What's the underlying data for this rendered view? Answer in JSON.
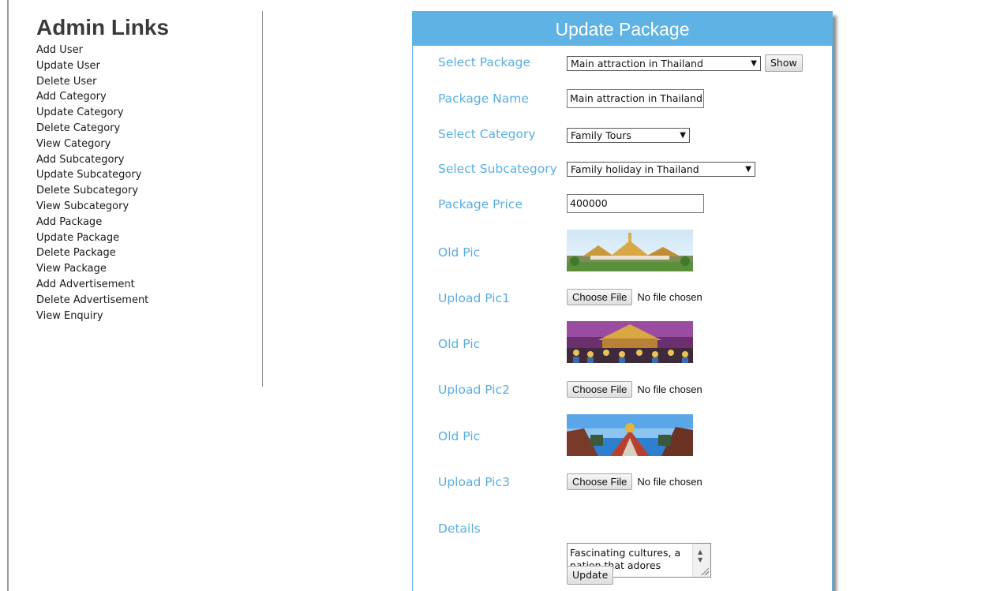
{
  "sidebar": {
    "title": "Admin Links",
    "links": [
      "Add User",
      "Update User",
      "Delete User",
      "Add Category",
      "Update Category",
      "Delete Category",
      "View Category",
      "Add Subcategory",
      "Update Subcategory",
      "Delete Subcategory",
      "View Subcategory",
      "Add Package",
      "Update Package",
      "Delete Package",
      "View Package",
      "Add Advertisement",
      "Delete Advertisement",
      "View Enquiry"
    ]
  },
  "form": {
    "title": "Update Package",
    "select_package": {
      "label": "Select Package",
      "value": "Main attraction in Thailand",
      "show_button": "Show"
    },
    "package_name": {
      "label": "Package Name",
      "value": "Main attraction in Thailand"
    },
    "select_category": {
      "label": "Select Category",
      "value": "Family Tours"
    },
    "select_subcategory": {
      "label": "Select Subcategory",
      "value": "Family holiday in Thailand"
    },
    "package_price": {
      "label": "Package Price",
      "value": "400000"
    },
    "old_pic_label": "Old Pic",
    "upload_pic1": {
      "label": "Upload Pic1",
      "button": "Choose File",
      "status": "No file chosen"
    },
    "upload_pic2": {
      "label": "Upload Pic2",
      "button": "Choose File",
      "status": "No file chosen"
    },
    "upload_pic3": {
      "label": "Upload Pic3",
      "button": "Choose File",
      "status": "No file chosen"
    },
    "details": {
      "label": "Details",
      "value": "Fascinating cultures, a nation that adores"
    },
    "update_button": "Update"
  },
  "colors": {
    "accent": "#5eb2e4",
    "label": "#5aaee0"
  }
}
